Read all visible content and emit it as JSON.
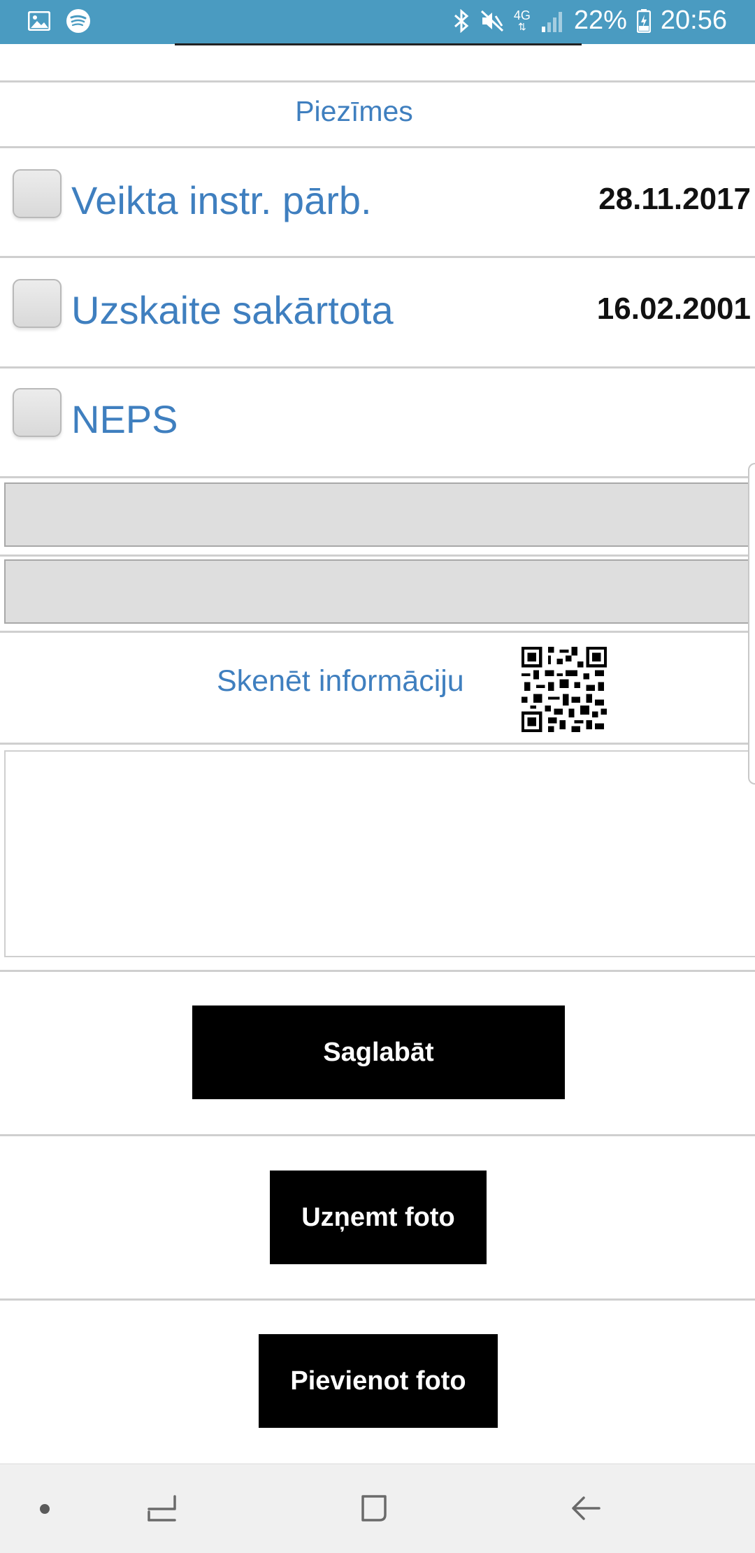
{
  "status_bar": {
    "left_icons": [
      "image-icon",
      "spotify-icon"
    ],
    "right_icons": [
      "bluetooth-icon",
      "mute-icon",
      "network-4g-icon",
      "signal-icon",
      "battery-icon"
    ],
    "network": "4G",
    "battery": "22%",
    "time": "20:56"
  },
  "notes": {
    "title": "Piezīmes"
  },
  "checkboxes": [
    {
      "label": "Veikta instr. pārb.",
      "date": "28.11.2017",
      "checked": false
    },
    {
      "label": "Uzskaite sakārtota",
      "date": "16.02.2001",
      "checked": false
    },
    {
      "label": "NEPS",
      "date": "",
      "checked": false
    }
  ],
  "inputs": [
    {
      "value": "",
      "placeholder": ""
    },
    {
      "value": "",
      "placeholder": ""
    }
  ],
  "scan": {
    "label": "Skenēt informāciju",
    "icon": "qr-code-icon"
  },
  "textarea": {
    "value": ""
  },
  "buttons": {
    "save": "Saglabāt",
    "take_photo": "Uzņemt foto",
    "add_photo": "Pievienot foto"
  },
  "nav_bar": {
    "icons": [
      "dot-icon",
      "recent-apps-icon",
      "home-icon",
      "back-icon"
    ]
  },
  "colors": {
    "status_bar": "#4a9bc1",
    "label_blue": "#3f7fbf",
    "button": "#000000"
  }
}
